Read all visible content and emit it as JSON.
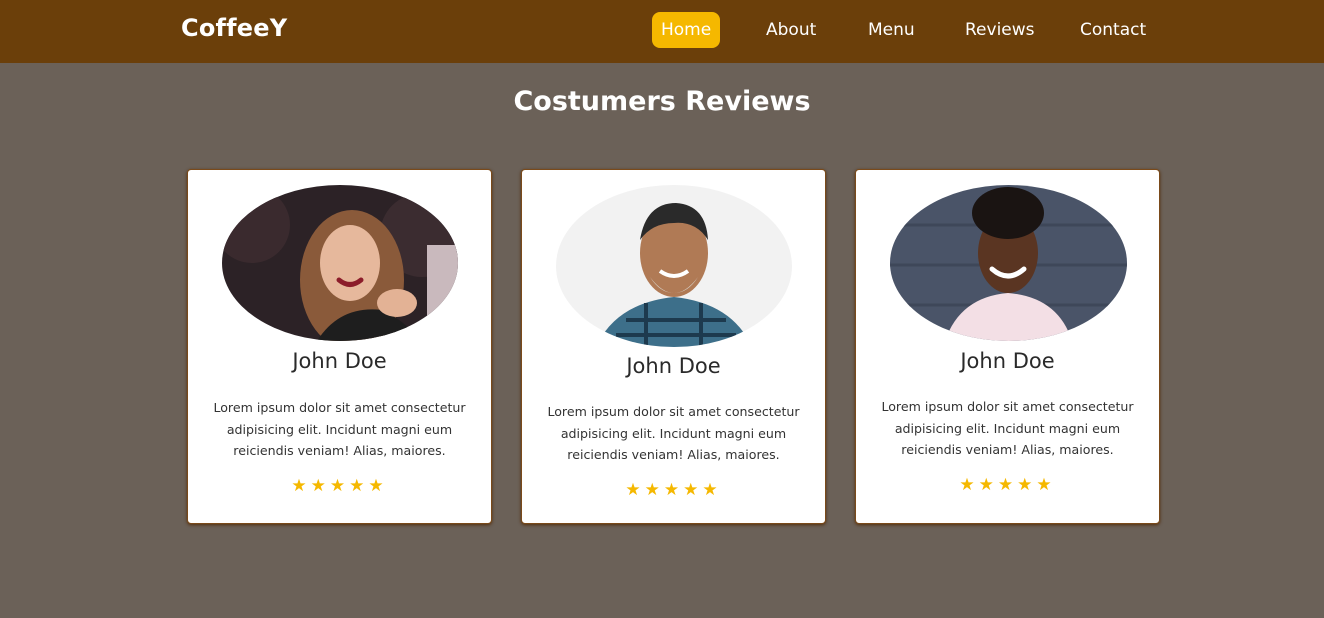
{
  "nav": {
    "brand": "CoffeeY",
    "links": [
      {
        "label": "Home",
        "active": true
      },
      {
        "label": "About",
        "active": false
      },
      {
        "label": "Menu",
        "active": false
      },
      {
        "label": "Reviews",
        "active": false
      },
      {
        "label": "Contact",
        "active": false
      }
    ]
  },
  "section": {
    "title": "Costumers Reviews"
  },
  "reviews": [
    {
      "avatar_icon": "woman-portrait-photo",
      "name": "John Doe",
      "text": "Lorem ipsum dolor sit amet consectetur adipisicing elit. Incidunt magni eum reiciendis veniam! Alias, maiores.",
      "rating": 5,
      "stars": "★★★★★"
    },
    {
      "avatar_icon": "man-portrait-photo",
      "name": "John Doe",
      "text": "Lorem ipsum dolor sit amet consectetur adipisicing elit. Incidunt magni eum reiciendis veniam! Alias, maiores.",
      "rating": 5,
      "stars": "★★★★★"
    },
    {
      "avatar_icon": "woman-portrait-photo",
      "name": "John Doe",
      "text": "Lorem ipsum dolor sit amet consectetur adipisicing elit. Incidunt magni eum reiciendis veniam! Alias, maiores.",
      "rating": 5,
      "stars": "★★★★★"
    }
  ],
  "colors": {
    "navbar_bg": "#6b3f0a",
    "page_bg": "#6b6158",
    "accent": "#f5b800",
    "card_bg": "#ffffff"
  }
}
